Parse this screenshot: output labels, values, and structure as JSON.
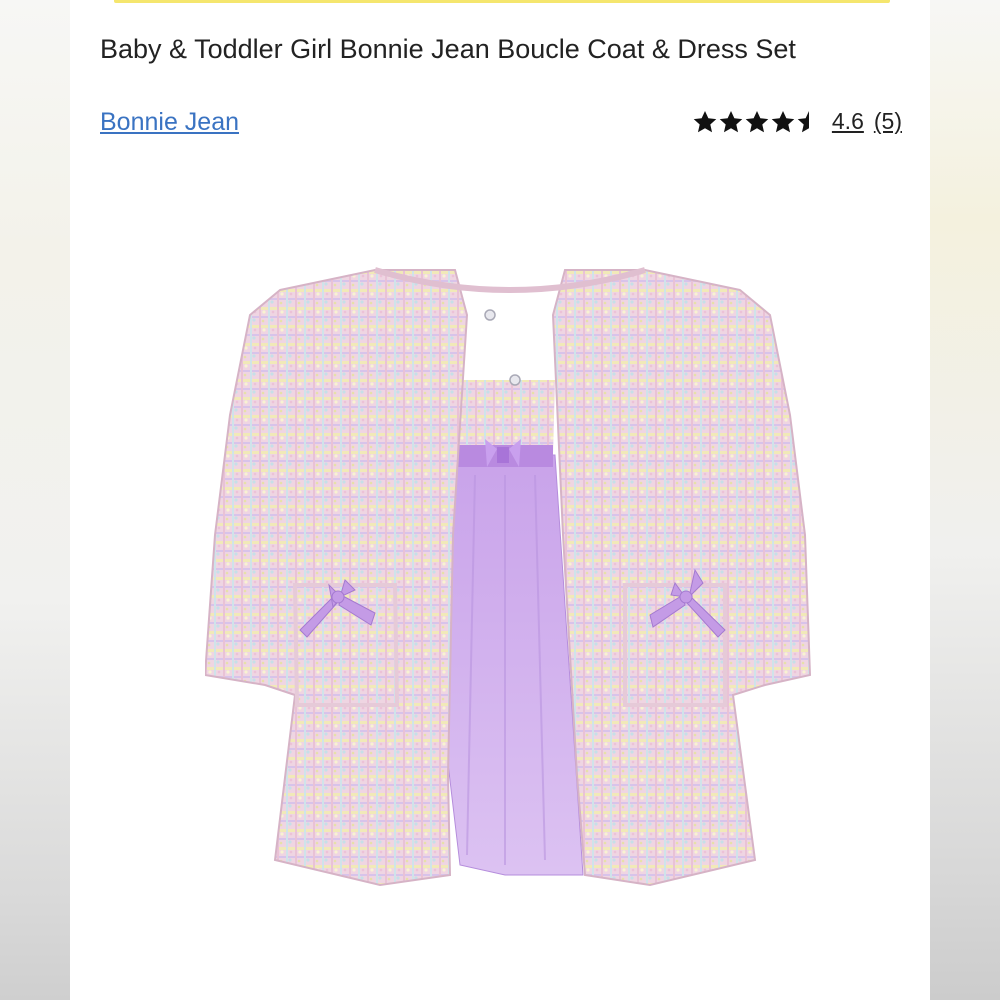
{
  "product": {
    "title": "Baby & Toddler Girl Bonnie Jean Boucle Coat & Dress Set",
    "brand": "Bonnie Jean",
    "rating_value": "4.6",
    "review_count": "(5)",
    "stars_filled": 4.6,
    "stars_total": 5
  },
  "colors": {
    "brand_link": "#3a73c2",
    "accent_strip": "#f5e66e",
    "coat_pink": "#ecd1de",
    "dress_lilac": "#c9a3e8",
    "bow_lilac": "#b98ae0"
  },
  "icons": [
    "star-icon",
    "half-star-icon"
  ]
}
